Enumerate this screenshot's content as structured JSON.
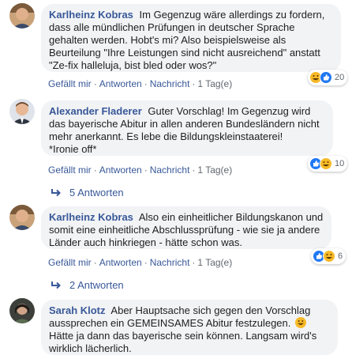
{
  "comments": [
    {
      "author": "Karlheinz Kobras",
      "text": "Im Gegenzug wäre allerdings zu fordern, dass alle mündlichen Prüfungen in deutscher Sprache gehalten werden. Hobt's mi? Also beispielsweise als Beurteilung \"Ihre Leistungen sind nicht ausreichend\" anstatt \"Ze-fix halleluja, bist bled oder wos?\"",
      "like": "Gefällt mir",
      "reply": "Antworten",
      "message": "Nachricht",
      "time": "1 Tag(e)",
      "reaction_count": "20",
      "reaction_icons": [
        "haha-icon",
        "like-icon"
      ]
    },
    {
      "author": "Alexander Fladerer",
      "text_lines": [
        "Guter Vorschlag! Im Gegenzug wird das bayerische Abitur in allen anderen Bundesländern nicht mehr anerkannt. Es lebe die Bildungskleinstaaterei!",
        "*Ironie off*"
      ],
      "like": "Gefällt mir",
      "reply": "Antworten",
      "message": "Nachricht",
      "time": "1 Tag(e)",
      "reaction_count": "10",
      "reaction_icons": [
        "like-icon",
        "haha-icon"
      ],
      "replies_label": "5 Antworten"
    },
    {
      "author": "Karlheinz Kobras",
      "text": "Also ein einheitlicher Bildungskanon und somit eine einheitliche Abschlussprüfung - wie sie ja andere Länder auch hinkriegen - hätte schon was.",
      "like": "Gefällt mir",
      "reply": "Antworten",
      "message": "Nachricht",
      "time": "1 Tag(e)",
      "reaction_count": "6",
      "reaction_icons": [
        "like-icon",
        "haha-icon"
      ],
      "replies_label": "2 Antworten"
    },
    {
      "author": "Sarah Klotz",
      "text_a": "Aber Hauptsache sich gegen den Vorschlag aussprechen ein GEMEINSAMES Abitur festzulegen.",
      "text_b": "Hätte ja dann das bayerische sein können. Langsam wird's wirklich lächerlich.",
      "emoji_icon": "grinning-emoji-icon"
    }
  ],
  "colors": {
    "link": "#385898",
    "bubble": "#f2f3f5",
    "meta": "#606770",
    "like_blue": "#2078f4",
    "haha_yellow": "#f7b928"
  }
}
